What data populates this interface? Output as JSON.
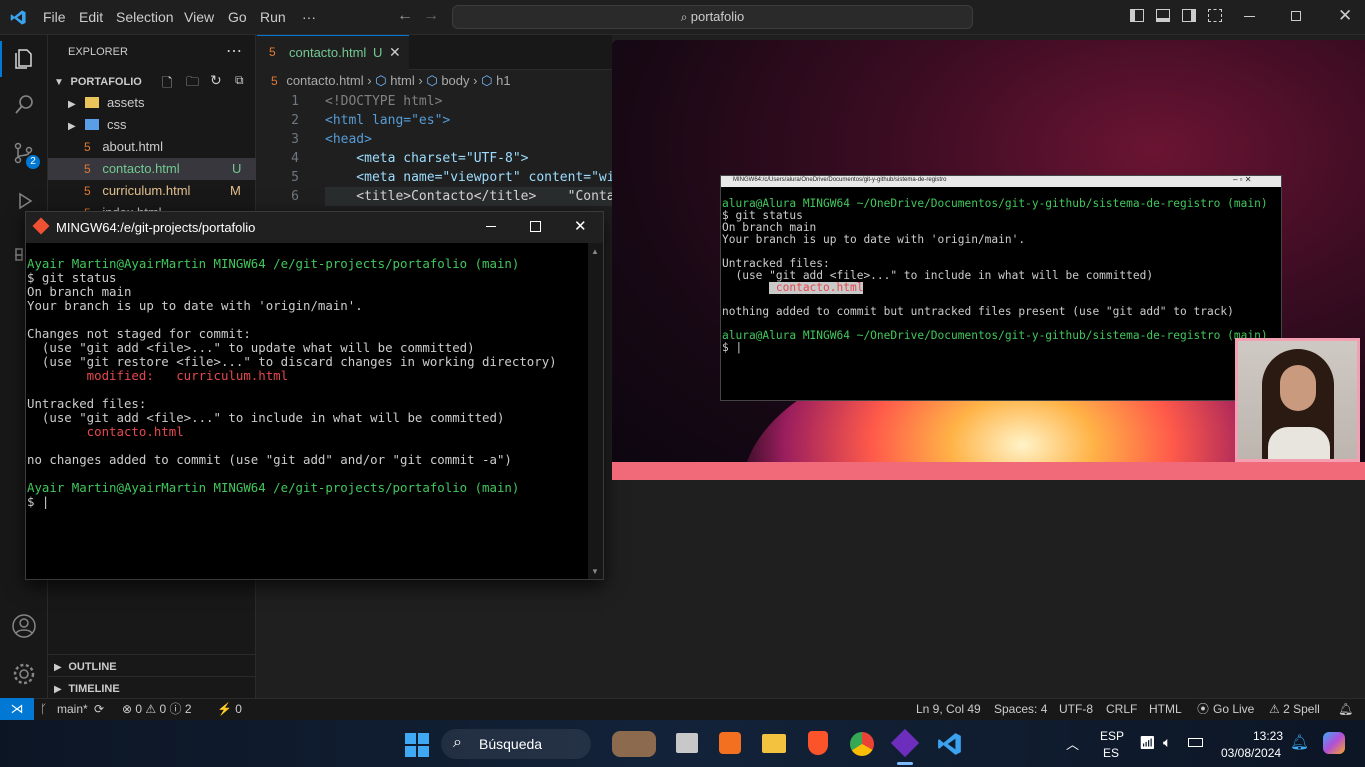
{
  "menu": {
    "items": [
      "File",
      "Edit",
      "Selection",
      "View",
      "Go",
      "Run",
      "···"
    ],
    "search": "portafolio"
  },
  "explorer": {
    "title": "EXPLORER",
    "folder": "PORTAFOLIO",
    "items": [
      {
        "name": "assets",
        "type": "folder"
      },
      {
        "name": "css",
        "type": "folder"
      },
      {
        "name": "about.html",
        "type": "file",
        "badge": ""
      },
      {
        "name": "contacto.html",
        "type": "file",
        "badge": "U"
      },
      {
        "name": "curriculum.html",
        "type": "file",
        "badge": "M"
      },
      {
        "name": "index.html",
        "type": "file",
        "badge": ""
      }
    ],
    "outline": "OUTLINE",
    "timeline": "TIMELINE"
  },
  "editor": {
    "tab": "contacto.html",
    "tab_badge": "U",
    "breadcrumb": [
      "contacto.html",
      "html",
      "body",
      "h1"
    ],
    "lines": [
      {
        "n": "1",
        "t": "<!DOCTYPE html>"
      },
      {
        "n": "2",
        "t": "<html lang=\"es\">"
      },
      {
        "n": "3",
        "t": "<head>"
      },
      {
        "n": "4",
        "t": "    <meta charset=\"UTF-8\">"
      },
      {
        "n": "5",
        "t": "    <meta name=\"viewport\" content=\"wid"
      },
      {
        "n": "6",
        "t": "    <title>Contacto</title>    \"Conta"
      }
    ]
  },
  "git_window": {
    "title": "MINGW64:/e/git-projects/portafolio",
    "lines": [
      {
        "t": "",
        "c": "w"
      },
      {
        "t": "Ayair Martin@AyairMartin MINGW64 /e/git-projects/portafolio (main)",
        "c": "prompt"
      },
      {
        "t": "$ git status",
        "c": "w"
      },
      {
        "t": "On branch main",
        "c": "w"
      },
      {
        "t": "Your branch is up to date with 'origin/main'.",
        "c": "w"
      },
      {
        "t": "",
        "c": "w"
      },
      {
        "t": "Changes not staged for commit:",
        "c": "w"
      },
      {
        "t": "  (use \"git add <file>...\" to update what will be committed)",
        "c": "w"
      },
      {
        "t": "  (use \"git restore <file>...\" to discard changes in working directory)",
        "c": "w"
      },
      {
        "t": "        modified:   curriculum.html",
        "c": "r"
      },
      {
        "t": "",
        "c": "w"
      },
      {
        "t": "Untracked files:",
        "c": "w"
      },
      {
        "t": "  (use \"git add <file>...\" to include in what will be committed)",
        "c": "w"
      },
      {
        "t": "        contacto.html",
        "c": "r"
      },
      {
        "t": "",
        "c": "w"
      },
      {
        "t": "no changes added to commit (use \"git add\" and/or \"git commit -a\")",
        "c": "w"
      },
      {
        "t": "",
        "c": "w"
      },
      {
        "t": "Ayair Martin@AyairMartin MINGW64 /e/git-projects/portafolio (main)",
        "c": "prompt"
      },
      {
        "t": "$ |",
        "c": "w"
      }
    ]
  },
  "video_terminal": {
    "title": "MINGW64:/c/Users/alura/OneDrive/Documentos/git-y-github/sistema-de-registro",
    "lines": [
      {
        "t": "alura@Alura MINGW64 ~/OneDrive/Documentos/git-y-github/sistema-de-registro (main)",
        "c": "prompt2"
      },
      {
        "t": "$ git status",
        "c": "w"
      },
      {
        "t": "On branch main",
        "c": "w"
      },
      {
        "t": "Your branch is up to date with 'origin/main'.",
        "c": "w"
      },
      {
        "t": "",
        "c": "w"
      },
      {
        "t": "Untracked files:",
        "c": "w"
      },
      {
        "t": "  (use \"git add <file>...\" to include in what will be committed)",
        "c": "w"
      },
      {
        "t": "        contacto.html",
        "c": "hl"
      },
      {
        "t": "",
        "c": "w"
      },
      {
        "t": "nothing added to commit but untracked files present (use \"git add\" to track)",
        "c": "w"
      },
      {
        "t": "",
        "c": "w"
      },
      {
        "t": "alura@Alura MINGW64 ~/OneDrive/Documentos/git-y-github/sistema-de-registro (main)",
        "c": "prompt2"
      },
      {
        "t": "$ |",
        "c": "w"
      }
    ]
  },
  "statusbar": {
    "branch": "main*",
    "problems": "⊗ 0 ⚠ 0 ⓘ 2",
    "ports": "⚡ 0",
    "position": "Ln 9, Col 49",
    "spaces": "Spaces: 4",
    "encoding": "UTF-8",
    "eol": "CRLF",
    "language": "HTML",
    "golive": "Go Live",
    "spell": "⚠ 2 Spell"
  },
  "taskbar": {
    "search": "Búsqueda",
    "lang1": "ESP",
    "lang2": "ES",
    "time": "13:23",
    "date": "03/08/2024",
    "source_count": "2"
  },
  "colors": {
    "accent": "#0078d4",
    "prompt_green": "#41c75c",
    "prompt_purple": "#b169ff",
    "prompt_yellow": "#c8b630",
    "git_red": "#e5484d"
  }
}
